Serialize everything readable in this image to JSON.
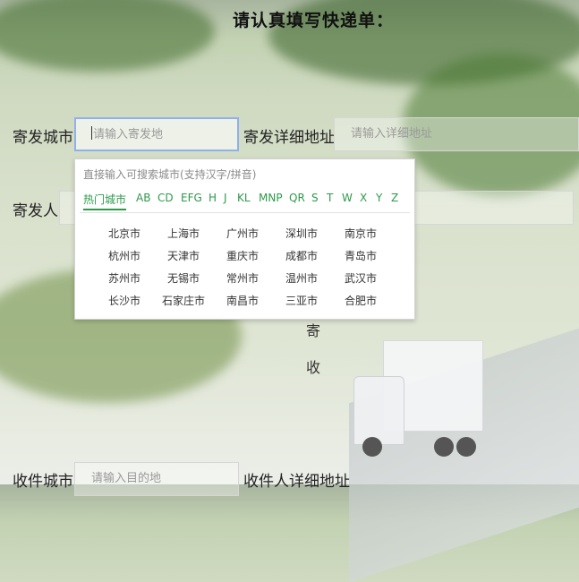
{
  "page": {
    "title": "请认真填写快递单：",
    "side_label_top": "寄",
    "side_label_bottom": "收"
  },
  "form": {
    "origin_city_label": "寄发城市",
    "origin_city_placeholder": "请输入寄发地",
    "origin_address_label": "寄发详细地址",
    "origin_address_placeholder": "请输入详细地址",
    "sender_label": "寄发人",
    "dest_city_label": "收件城市",
    "dest_city_placeholder": "请输入目的地",
    "dest_address_label": "收件人详细地址"
  },
  "city_picker": {
    "hint": "直接输入可搜索城市(支持汉字/拼音)",
    "tabs": [
      "热门城市",
      "AB",
      "CD",
      "EFG",
      "H",
      "J",
      "KL",
      "MNP",
      "QR",
      "S",
      "T",
      "W",
      "X",
      "Y",
      "Z"
    ],
    "active_tab": "热门城市",
    "cities": [
      [
        "北京市",
        "上海市",
        "广州市",
        "深圳市",
        "南京市"
      ],
      [
        "杭州市",
        "天津市",
        "重庆市",
        "成都市",
        "青岛市"
      ],
      [
        "苏州市",
        "无锡市",
        "常州市",
        "温州市",
        "武汉市"
      ],
      [
        "长沙市",
        "石家庄市",
        "南昌市",
        "三亚市",
        "合肥市"
      ]
    ]
  },
  "colors": {
    "accent_green": "#2d9a4a",
    "focus_border": "#8fb1e8"
  }
}
